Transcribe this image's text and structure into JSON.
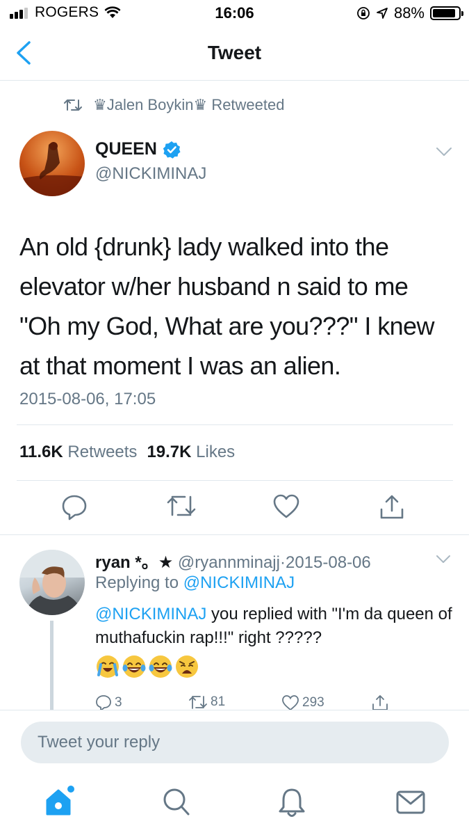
{
  "status_bar": {
    "carrier": "ROGERS",
    "time": "16:06",
    "battery": "88%",
    "battery_level": 0.88
  },
  "nav": {
    "title": "Tweet",
    "back_icon": "chevron-left-icon"
  },
  "retweet_context": {
    "retweeter": "♛Jalen Boykin♛",
    "label": "Retweeted"
  },
  "tweet": {
    "author_name": "QUEEN",
    "author_handle": "@NICKIMINAJ",
    "verified": true,
    "text": "An old {drunk} lady walked into the elevator w/her husband n said to me \"Oh my God, What are you???\" I knew at that moment I was an alien.",
    "date": "2015-08-06, 17:05",
    "retweets_count": "11.6K",
    "retweets_label": "Retweets",
    "likes_count": "19.7K",
    "likes_label": "Likes"
  },
  "reply": {
    "name": "ryan *。★",
    "handle": "@ryannminajj",
    "sep": "·",
    "date": "2015-08-06",
    "replying_prefix": "Replying to",
    "replying_to": "@NICKIMINAJ",
    "mention": "@NICKIMINAJ",
    "text": " you replied with \"I'm da queen of muthafuckin rap!!!\" right ?????",
    "emojis": [
      "crying-laughing",
      "joy",
      "joy",
      "weary"
    ],
    "reply_count": "3",
    "retweet_count": "81",
    "like_count": "293"
  },
  "composer": {
    "placeholder": "Tweet your reply"
  },
  "colors": {
    "accent": "#1da1f2",
    "secondary_text": "#657786",
    "divider": "#e1e8ed"
  }
}
